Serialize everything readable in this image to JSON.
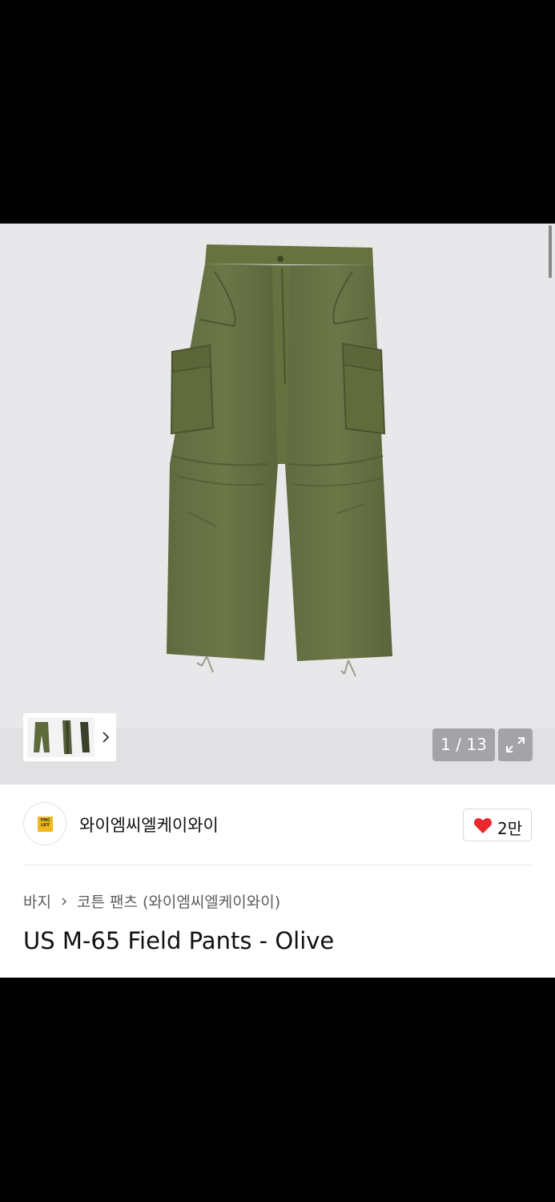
{
  "gallery": {
    "counter": "1 / 13",
    "current_index": 1,
    "total_images": 13,
    "main_image": "olive-cargo-field-pants-photo",
    "expand_icon": "expand-icon",
    "next_icon": "chevron-right-icon"
  },
  "brand": {
    "name": "와이엠씨엘케이와이",
    "logo_text": "YMC LKY",
    "logo_color": "#f1b81d"
  },
  "like": {
    "count": "2만",
    "icon": "heart-icon",
    "icon_color": "#e8282e"
  },
  "breadcrumb": {
    "category": "바지",
    "subcategory": "코튼 팬츠 (와이엠씨엘케이와이)",
    "separator_icon": "chevron-right-icon"
  },
  "product": {
    "title": "US M-65 Field Pants - Olive"
  }
}
